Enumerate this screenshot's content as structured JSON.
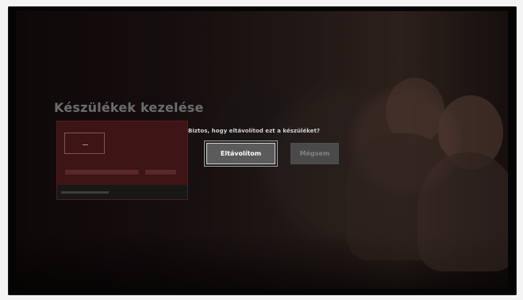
{
  "screen": {
    "title": "Készülékek kezelése"
  },
  "dialog": {
    "prompt": "Biztos, hogy eltávolítod ezt a készüléket?",
    "primary_button": "Eltávolítom",
    "secondary_button": "Mégsem"
  }
}
